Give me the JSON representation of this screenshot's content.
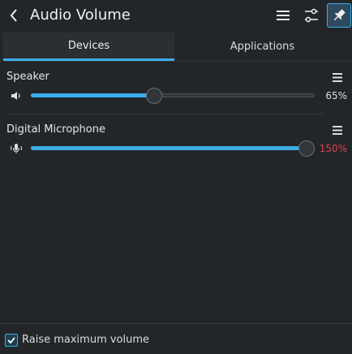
{
  "header": {
    "title": "Audio Volume",
    "back_icon": "chevron-left-icon",
    "hamburger_icon": "hamburger-menu-icon",
    "config_icon": "configure-sliders-icon",
    "pin_icon": "pin-icon",
    "pin_active": true
  },
  "tabs": [
    {
      "label": "Devices",
      "active": true
    },
    {
      "label": "Applications",
      "active": false
    }
  ],
  "devices": [
    {
      "name": "Speaker",
      "icon": "speaker-icon",
      "volume_percent": 65,
      "volume_label": "65%",
      "max_percent": 150
    },
    {
      "name": "Digital Microphone",
      "icon": "microphone-icon",
      "volume_percent": 150,
      "volume_label": "150%",
      "max_percent": 150
    }
  ],
  "footer": {
    "raise_max_volume_label": "Raise maximum volume",
    "raise_max_volume_checked": true
  },
  "colors": {
    "accent": "#3daee9",
    "background": "#232629",
    "over_volume": "#da4453"
  }
}
